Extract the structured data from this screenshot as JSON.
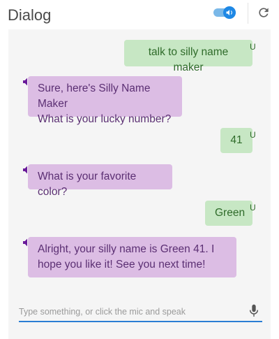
{
  "header": {
    "title": "Dialog",
    "toggle_on": true,
    "icons": {
      "toggle": "volume-toggle-icon",
      "refresh": "refresh-icon"
    }
  },
  "messages": [
    {
      "role": "user",
      "text": "talk to silly name maker",
      "badge": "U"
    },
    {
      "role": "bot",
      "lines": [
        "Sure, here's Silly Name Maker",
        "What is your lucky number?"
      ],
      "icon": "speaker-icon"
    },
    {
      "role": "user",
      "text": "41",
      "badge": "U"
    },
    {
      "role": "bot",
      "lines": [
        "What is your favorite color?"
      ],
      "icon": "speaker-icon"
    },
    {
      "role": "user",
      "text": "Green",
      "badge": "U"
    },
    {
      "role": "bot",
      "lines": [
        "Alright, your silly name is Green 41. I",
        "hope you like it! See you next time!"
      ],
      "icon": "speaker-icon"
    }
  ],
  "input": {
    "placeholder": "Type something, or click the mic and speak",
    "value": "",
    "icon": "mic-icon"
  },
  "colors": {
    "user_bubble": "#c7e7c4",
    "user_text": "#2f6b2a",
    "bot_bubble": "#dcbde4",
    "bot_text": "#5b2f73",
    "accent": "#1e88e5",
    "panel": "#f5f5f5"
  }
}
